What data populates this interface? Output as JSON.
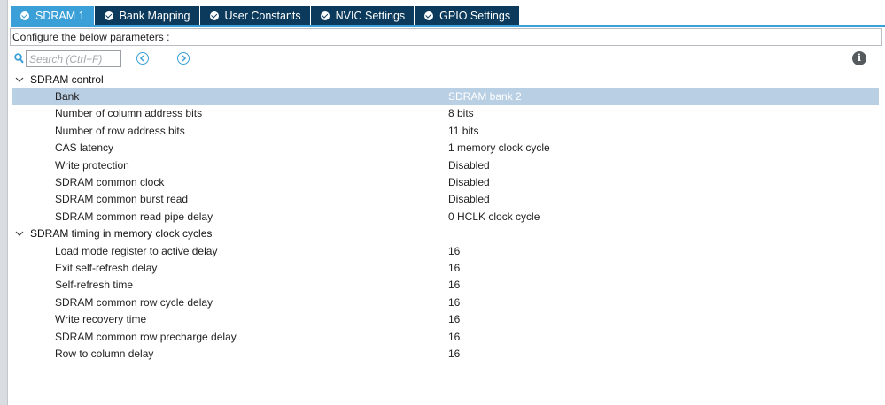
{
  "tabs": [
    {
      "label": "SDRAM 1",
      "active": true
    },
    {
      "label": "Bank Mapping",
      "active": false
    },
    {
      "label": "User Constants",
      "active": false
    },
    {
      "label": "NVIC Settings",
      "active": false
    },
    {
      "label": "GPIO Settings",
      "active": false
    }
  ],
  "config_label": "Configure the below parameters :",
  "search": {
    "placeholder": "Search (Ctrl+F)",
    "value": ""
  },
  "icons": {
    "search": "search-icon",
    "prev": "chevron-left-circle-icon",
    "next": "chevron-right-circle-icon",
    "info": "info-icon",
    "tab_check": "check-circle-icon",
    "group_toggle": "chevron-down-icon"
  },
  "colors": {
    "tab_active": "#3ba0d8",
    "tab_inactive": "#0b3a5c",
    "selected_row": "#b9cfe4",
    "nav_button": "#3ba0d8"
  },
  "groups": [
    {
      "label": "SDRAM control",
      "expanded": true,
      "rows": [
        {
          "name": "Bank",
          "value": "SDRAM bank 2",
          "selected": true
        },
        {
          "name": "Number of column address bits",
          "value": "8 bits"
        },
        {
          "name": "Number of row address bits",
          "value": "11 bits"
        },
        {
          "name": "CAS latency",
          "value": "1 memory clock cycle"
        },
        {
          "name": "Write protection",
          "value": "Disabled"
        },
        {
          "name": "SDRAM common clock",
          "value": "Disabled"
        },
        {
          "name": "SDRAM common burst read",
          "value": "Disabled"
        },
        {
          "name": "SDRAM common read pipe delay",
          "value": "0 HCLK clock cycle"
        }
      ]
    },
    {
      "label": "SDRAM timing in memory clock cycles",
      "expanded": true,
      "rows": [
        {
          "name": "Load mode register to active delay",
          "value": "16"
        },
        {
          "name": "Exit self-refresh delay",
          "value": "16"
        },
        {
          "name": "Self-refresh time",
          "value": "16"
        },
        {
          "name": "SDRAM common row cycle delay",
          "value": "16"
        },
        {
          "name": "Write recovery time",
          "value": "16"
        },
        {
          "name": "SDRAM common row precharge delay",
          "value": "16"
        },
        {
          "name": "Row to column delay",
          "value": "16"
        }
      ]
    }
  ]
}
